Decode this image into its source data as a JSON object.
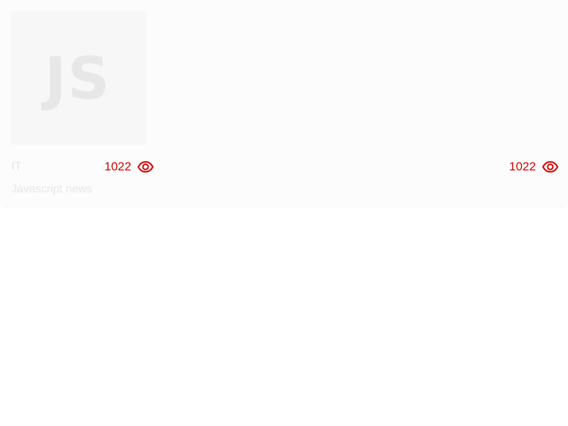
{
  "card": {
    "thumbnail_text": "JS",
    "category": "IT",
    "views_primary": "1022",
    "views_secondary": "1022",
    "title": "Javascript news",
    "view_icon": "eye-icon",
    "accent_color": "#d50000"
  }
}
